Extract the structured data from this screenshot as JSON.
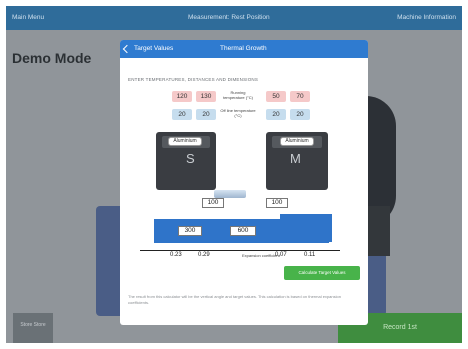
{
  "topbar": {
    "left": "Main Menu",
    "center": "Measurement: Rest Position",
    "right": "Machine Information"
  },
  "background": {
    "mode_label": "Demo Mode"
  },
  "footer": {
    "store_label": "Store\nStore",
    "record_label": "Record 1st"
  },
  "modal": {
    "back_label": "Target Values",
    "title": "Thermal Growth",
    "subtitle": "ENTER TEMPERATURES, DISTANCES AND DIMENSIONS",
    "row1": {
      "s_a": "120",
      "s_b": "130",
      "label": "Running temperature (°C)",
      "m_a": "50",
      "m_b": "70"
    },
    "row2": {
      "s_a": "20",
      "s_b": "20",
      "label": "Off line temperature (°C)",
      "m_a": "20",
      "m_b": "20"
    },
    "left_material": "Aluminium",
    "right_material": "Aluminium",
    "left_letter": "S",
    "right_letter": "M",
    "dims": {
      "height_left": "100",
      "height_right": "100",
      "dist_left": "300",
      "dist_mid": "600"
    },
    "coeffs": {
      "c1": "0.23",
      "c2": "0.29",
      "label": "Expansion coefficient",
      "c3": "0.07",
      "c4": "0.11"
    },
    "calc_button": "Calculate Target Values",
    "note": "The result from this calculator will be the vertical angle and target values. This calculation is based on thermal expansion coefficients."
  },
  "colors": {
    "accent": "#2f7bd0",
    "go": "#48b34a",
    "base": "#2f74c9"
  }
}
